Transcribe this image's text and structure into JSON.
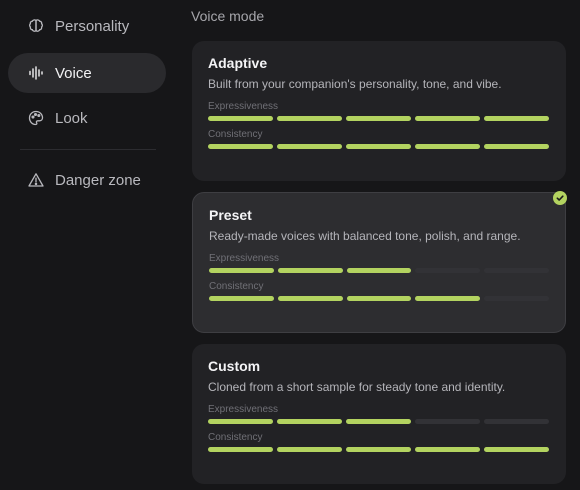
{
  "sidebar": {
    "items": [
      {
        "label": "Personality",
        "icon": "brain-icon"
      },
      {
        "label": "Voice",
        "icon": "waveform-icon",
        "active": true
      },
      {
        "label": "Look",
        "icon": "palette-icon"
      },
      {
        "label": "Danger zone",
        "icon": "warning-icon"
      }
    ]
  },
  "main": {
    "section_title": "Voice mode",
    "meter_labels": {
      "expressiveness": "Expressiveness",
      "consistency": "Consistency"
    },
    "cards": [
      {
        "title": "Adaptive",
        "description": "Built from your companion's personality, tone, and vibe.",
        "expressiveness": 5,
        "consistency": 5,
        "selected": false
      },
      {
        "title": "Preset",
        "description": "Ready-made voices with balanced tone, polish, and range.",
        "expressiveness": 3,
        "consistency": 4,
        "selected": true
      },
      {
        "title": "Custom",
        "description": "Cloned from a short sample for steady tone and identity.",
        "expressiveness": 3,
        "consistency": 5,
        "selected": false
      }
    ],
    "meter_max": 5
  },
  "colors": {
    "accent": "#b3d360",
    "background": "#161618",
    "card": "#222225",
    "card_selected": "#2d2d30"
  }
}
